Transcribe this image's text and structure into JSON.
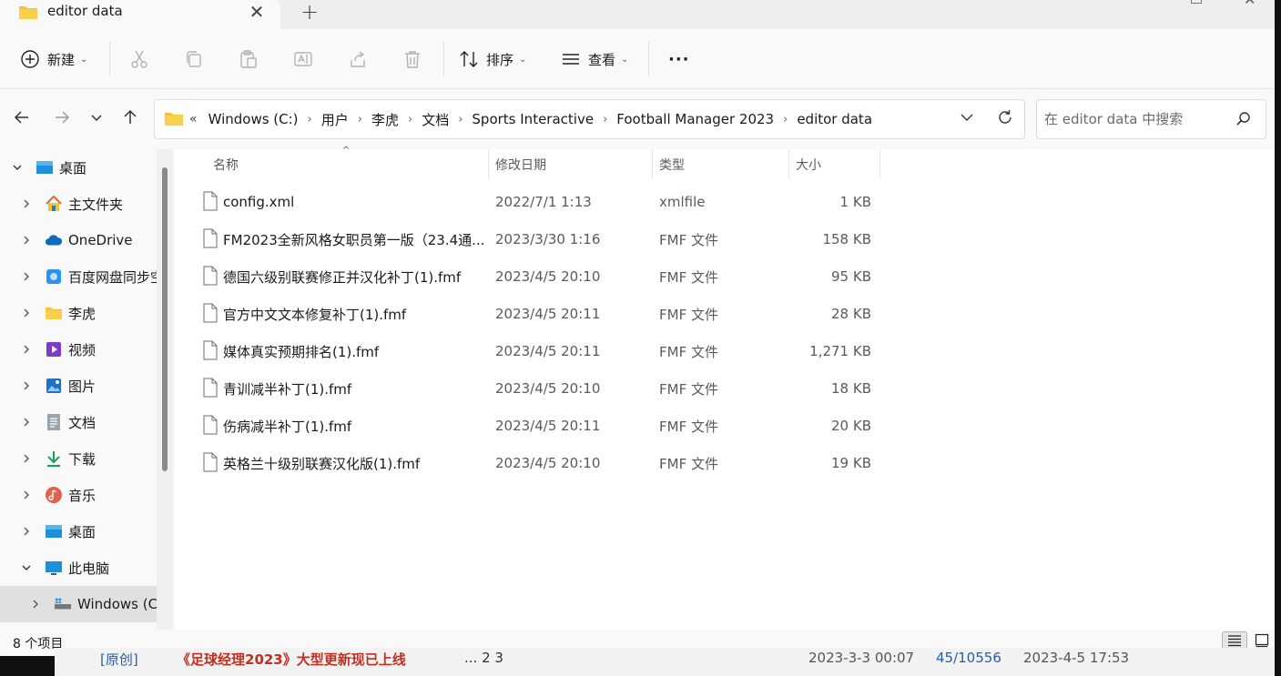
{
  "tab": {
    "title": "editor data",
    "close": "✕",
    "new": "+"
  },
  "toolbar": {
    "new_label": "新建",
    "sort_label": "排序",
    "view_label": "查看",
    "more": "···",
    "icons": [
      "plus-circle-icon",
      "cut-icon",
      "copy-icon",
      "paste-icon",
      "rename-icon",
      "share-icon",
      "delete-icon",
      "sort-icon",
      "view-icon",
      "more-icon"
    ]
  },
  "address": {
    "lead": "«",
    "crumbs": [
      "Windows (C:)",
      "用户",
      "李虎",
      "文档",
      "Sports Interactive",
      "Football Manager 2023",
      "editor data"
    ],
    "sep": "›"
  },
  "search": {
    "placeholder": "在 editor data 中搜索"
  },
  "sidebar": {
    "items": [
      {
        "label": "桌面",
        "icon": "desktop-icon",
        "expanded": true
      },
      {
        "label": "主文件夹",
        "icon": "home-icon"
      },
      {
        "label": "OneDrive",
        "icon": "cloud-icon"
      },
      {
        "label": "百度网盘同步空间",
        "icon": "baidu-sync-icon"
      },
      {
        "label": "李虎",
        "icon": "folder-icon"
      },
      {
        "label": "视频",
        "icon": "video-icon"
      },
      {
        "label": "图片",
        "icon": "pictures-icon"
      },
      {
        "label": "文档",
        "icon": "documents-icon"
      },
      {
        "label": "下载",
        "icon": "download-icon"
      },
      {
        "label": "音乐",
        "icon": "music-icon"
      },
      {
        "label": "桌面",
        "icon": "desktop-icon"
      },
      {
        "label": "此电脑",
        "icon": "computer-icon",
        "expanded": true
      },
      {
        "label": "Windows (C:)",
        "icon": "drive-icon",
        "selected": true
      }
    ]
  },
  "columns": {
    "name": "名称",
    "modified": "修改日期",
    "type": "类型",
    "size": "大小"
  },
  "files": [
    {
      "name": "config.xml",
      "modified": "2022/7/1 1:13",
      "type": "xmlfile",
      "size": "1 KB"
    },
    {
      "name": "FM2023全新风格女职员第一版（23.4通...",
      "modified": "2023/3/30 1:16",
      "type": "FMF 文件",
      "size": "158 KB"
    },
    {
      "name": "德国六级别联赛修正并汉化补丁(1).fmf",
      "modified": "2023/4/5 20:10",
      "type": "FMF 文件",
      "size": "95 KB"
    },
    {
      "name": "官方中文文本修复补丁(1).fmf",
      "modified": "2023/4/5 20:11",
      "type": "FMF 文件",
      "size": "28 KB"
    },
    {
      "name": "媒体真实预期排名(1).fmf",
      "modified": "2023/4/5 20:11",
      "type": "FMF 文件",
      "size": "1,271 KB"
    },
    {
      "name": "青训减半补丁(1).fmf",
      "modified": "2023/4/5 20:10",
      "type": "FMF 文件",
      "size": "18 KB"
    },
    {
      "name": "伤病减半补丁(1).fmf",
      "modified": "2023/4/5 20:11",
      "type": "FMF 文件",
      "size": "20 KB"
    },
    {
      "name": "英格兰十级别联赛汉化版(1).fmf",
      "modified": "2023/4/5 20:10",
      "type": "FMF 文件",
      "size": "19 KB"
    }
  ],
  "status": {
    "count": "8 个项目"
  },
  "background": {
    "items": [
      "[原创]",
      "《足球经理2023》大型更新现已上线",
      "... 2  3",
      "2023-3-3 00:07",
      "45/10556",
      "2023-4-5 17:53"
    ]
  },
  "colors": {
    "folder": "#f3c13a",
    "accent": "#0067c0",
    "selected": "#e0e0e0"
  }
}
